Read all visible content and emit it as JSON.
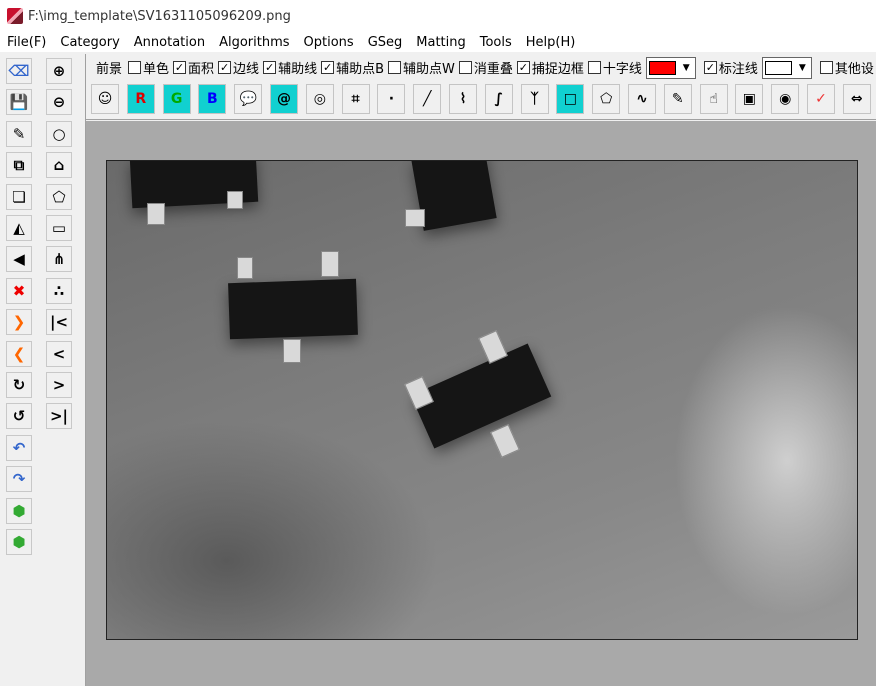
{
  "title": "F:\\img_template\\SV1631105096209.png",
  "menu": [
    "File(F)",
    "Category",
    "Annotation",
    "Algorithms",
    "Options",
    "GSeg",
    "Matting",
    "Tools",
    "Help(H)"
  ],
  "options": {
    "foreground": "前景",
    "items": [
      {
        "label": "单色",
        "checked": false
      },
      {
        "label": "面积",
        "checked": true
      },
      {
        "label": "边线",
        "checked": true
      },
      {
        "label": "辅助线",
        "checked": true
      },
      {
        "label": "辅助点B",
        "checked": true
      },
      {
        "label": "辅助点W",
        "checked": false
      },
      {
        "label": "消重叠",
        "checked": false
      },
      {
        "label": "捕捉边框",
        "checked": true
      },
      {
        "label": "十字线",
        "checked": false
      }
    ],
    "color1": "#ff0000",
    "label_line": {
      "label": "标注线",
      "checked": true
    },
    "color2": "#ffffff",
    "other": {
      "label": "其他设",
      "checked": false
    }
  },
  "tools": [
    "avatar-icon",
    "R",
    "G",
    "B",
    "speech-icon",
    "@",
    "spiral-icon",
    "crop-icon",
    "·",
    "line-icon",
    "polyline-icon",
    "curve-icon",
    "branch-icon",
    "rect-icon",
    "polygon-icon",
    "freeform-icon",
    "brush-icon",
    "hand-icon",
    "frame-icon",
    "stop-icon",
    "✓",
    "split-icon"
  ],
  "left_tools_col1": [
    "eraser-icon",
    "save-icon",
    "edit-icon",
    "copy-icon",
    "layers-icon",
    "flip-icon",
    "left-arrow-icon",
    "delete-icon",
    "next-icon",
    "prev-icon",
    "redo-icon",
    "undo-icon",
    "back-icon",
    "forward-icon",
    "shape1-icon",
    "shape2-icon"
  ],
  "left_tools_col2": [
    "zoom-in-icon",
    "zoom-out-icon",
    "circle-icon",
    "poly-add-icon",
    "quad-add-icon",
    "rect-add-icon",
    "node-icon",
    "dot-icon",
    "first-icon",
    "left-chevron-icon",
    "right-chevron-icon",
    "last-icon"
  ]
}
